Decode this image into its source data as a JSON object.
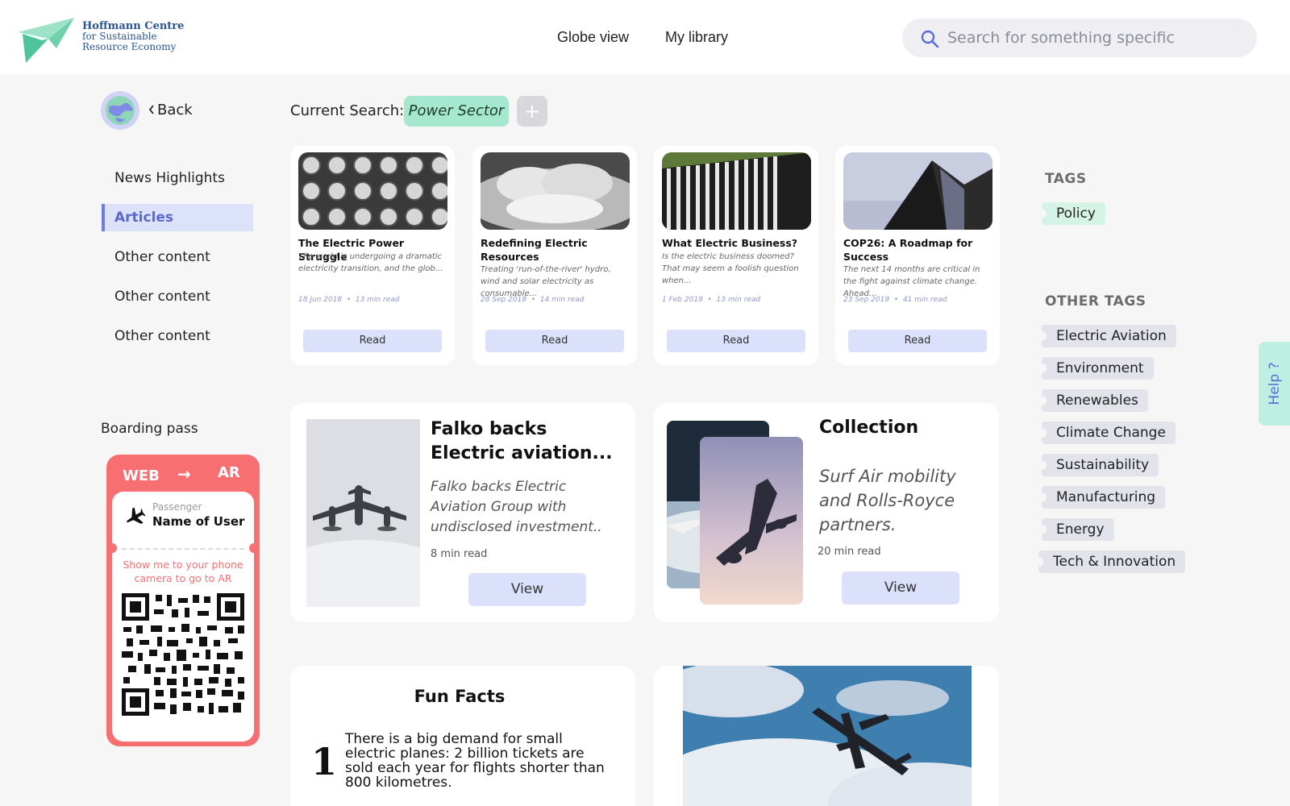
{
  "header": {
    "logo": {
      "line1": "Hoffmann Centre",
      "line2": "for Sustainable",
      "line3": "Resource Economy"
    },
    "nav": {
      "globe_view": "Globe view",
      "my_library": "My library"
    },
    "search": {
      "placeholder": "Search for something specific",
      "value": ""
    }
  },
  "sidebar": {
    "back_label": "Back",
    "items": [
      {
        "label": "News Highlights"
      },
      {
        "label": "Articles",
        "active": true
      },
      {
        "label": "Other content"
      },
      {
        "label": "Other content"
      },
      {
        "label": "Other content"
      }
    ]
  },
  "boarding_pass": {
    "title": "Boarding pass",
    "from": "WEB",
    "arrow": "→",
    "to": "AR",
    "passenger_label": "Passenger",
    "passenger_name": "Name of User",
    "message": "Show me to your phone camera to go to AR"
  },
  "current_search": {
    "label": "Current Search:",
    "chip": "Power Sector",
    "add": "+"
  },
  "articles": [
    {
      "title": "The Electric Power Struggle",
      "excerpt": "The world is undergoing a dramatic electricity transition, and the glob...",
      "date": "18 Jun 2018",
      "read_time": "13 min read",
      "button": "Read"
    },
    {
      "title": "Redefining Electric Resources",
      "excerpt": "Treating 'run-of-the-river' hydro, wind and solar electricity as consumable...",
      "date": "28 Sep 2018",
      "read_time": "14 min read",
      "button": "Read"
    },
    {
      "title": "What Electric Business?",
      "excerpt": "Is the electric business doomed? That may seem a foolish question when...",
      "date": "1 Feb 2019",
      "read_time": "13 min read",
      "button": "Read"
    },
    {
      "title": "COP26: A Roadmap for Success",
      "excerpt": "The next 14 months are critical in the fight against climate change. Ahead...",
      "date": "23 Sep 2019",
      "read_time": "41 min read",
      "button": "Read"
    }
  ],
  "feature": {
    "title": "Falko backs Electric aviation...",
    "excerpt": "Falko backs Electric Aviation Group with undisclosed investment..",
    "read_time": "8 min read",
    "button": "View"
  },
  "collection": {
    "title": "Collection",
    "description": "Surf Air mobility and Rolls-Royce partners.",
    "read_time": "20 min read",
    "button": "View"
  },
  "fun_facts": {
    "title": "Fun Facts",
    "number": "1",
    "text": "There is a big demand for small electric planes: 2 billion tickets are sold each year for flights shorter than 800 kilometres."
  },
  "tags": {
    "heading": "TAGS",
    "items": [
      "Policy"
    ]
  },
  "other_tags": {
    "heading": "OTHER TAGS",
    "items": [
      "Electric Aviation",
      "Environment",
      "Renewables",
      "Climate Change",
      "Sustainability",
      "Manufacturing",
      "Energy",
      "Tech & Innovation"
    ]
  },
  "help": {
    "label": "Help ?"
  },
  "colors": {
    "accent": "#6f7edb",
    "chip": "#a5e8cf",
    "boarding_pass": "#f86f72",
    "button": "#dbe0fb",
    "help_tab": "#bdf0e2"
  },
  "icons": {
    "search": "search-icon",
    "plane": "plane-icon",
    "globe": "globe-icon",
    "chevron": "chevron-left-icon"
  }
}
